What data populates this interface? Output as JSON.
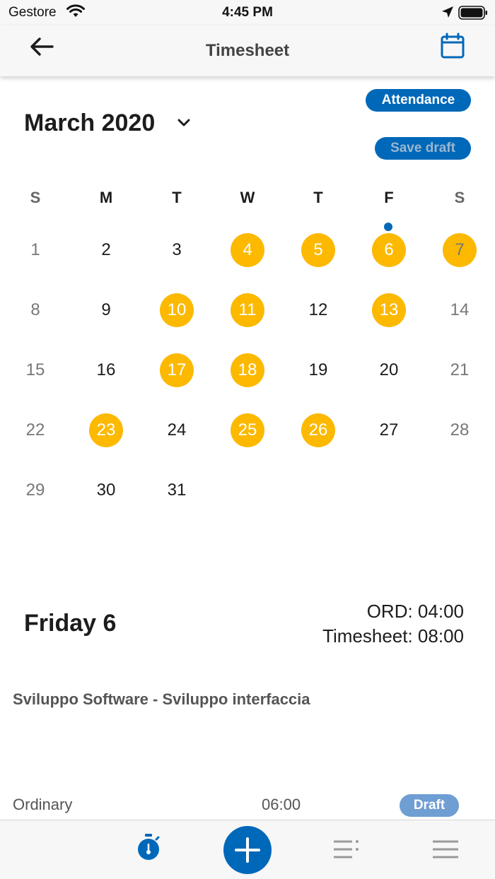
{
  "status_bar": {
    "carrier": "Gestore",
    "time": "4:45 PM"
  },
  "navbar": {
    "title": "Timesheet",
    "back_icon": "arrow-left-icon",
    "calendar_icon": "calendar-icon"
  },
  "header": {
    "attendance_label": "Attendance",
    "save_draft_label": "Save draft",
    "month_label": "March 2020",
    "accent_color": "#0068b9",
    "marked_day_color": "#fcb900"
  },
  "calendar": {
    "weekdays": [
      "S",
      "M",
      "T",
      "W",
      "T",
      "F",
      "S"
    ],
    "weeks": [
      [
        "1",
        "2",
        "3",
        "4",
        "5",
        "6",
        "7"
      ],
      [
        "8",
        "9",
        "10",
        "11",
        "12",
        "13",
        "14"
      ],
      [
        "15",
        "16",
        "17",
        "18",
        "19",
        "20",
        "21"
      ],
      [
        "22",
        "23",
        "24",
        "25",
        "26",
        "27",
        "28"
      ],
      [
        "29",
        "30",
        "31"
      ]
    ],
    "marked_days": [
      4,
      5,
      6,
      7,
      10,
      11,
      13,
      17,
      18,
      23,
      25,
      26
    ],
    "event_dot_day": 6
  },
  "details": {
    "day_title": "Friday 6",
    "ord": "ORD: 04:00",
    "timesheet": "Timesheet: 08:00",
    "activity": "Sviluppo Software - Sviluppo interfaccia",
    "entry_label": "Ordinary",
    "entry_hours": "06:00",
    "entry_status": "Draft"
  },
  "tabbar": {
    "items": [
      "stopwatch-icon",
      "plus-icon",
      "list-icon",
      "menu-icon"
    ]
  }
}
